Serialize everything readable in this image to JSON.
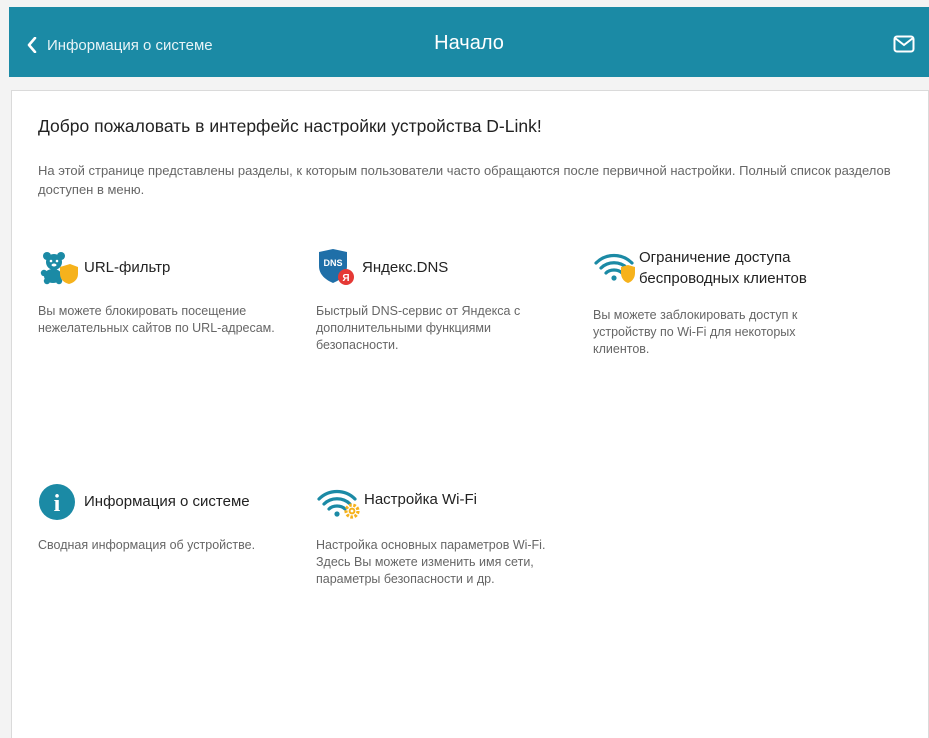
{
  "header": {
    "back_label": "Информация о системе",
    "title": "Начало",
    "bg_color": "#1b8aa5"
  },
  "main": {
    "heading": "Добро пожаловать в интерфейс настройки устройства D-Link!",
    "intro": "На этой странице представлены разделы, к которым пользователи часто обращаются после первичной настройки. Полный список разделов доступен в меню.",
    "tiles": [
      {
        "icon": "url-filter-icon",
        "name": "URL-фильтр",
        "desc": "Вы можете блокировать посещение нежелательных сайтов по URL-адресам."
      },
      {
        "icon": "yandex-dns-icon",
        "icon_text": "DNS",
        "name": "Яндекс.DNS",
        "desc": "Быстрый DNS-сервис от Яндекса с дополнительными функциями безопасности."
      },
      {
        "icon": "wifi-shield-icon",
        "name": "Ограничение доступа беспроводных клиентов",
        "desc": "Вы можете заблокировать доступ к устройству по Wi-Fi для некоторых клиентов."
      },
      {
        "icon": "info-icon",
        "icon_text": "i",
        "name": "Информация о системе",
        "desc": "Сводная информация об устройстве."
      },
      {
        "icon": "wifi-gear-icon",
        "name": "Настройка Wi-Fi",
        "desc": "Настройка основных параметров Wi-Fi. Здесь Вы можете изменить имя сети, параметры безопасности и др."
      }
    ]
  },
  "colors": {
    "accent": "#1b8aa5",
    "shield": "#f6b21c",
    "dns_blue": "#1f6fa8",
    "yandex_red": "#e53935"
  }
}
